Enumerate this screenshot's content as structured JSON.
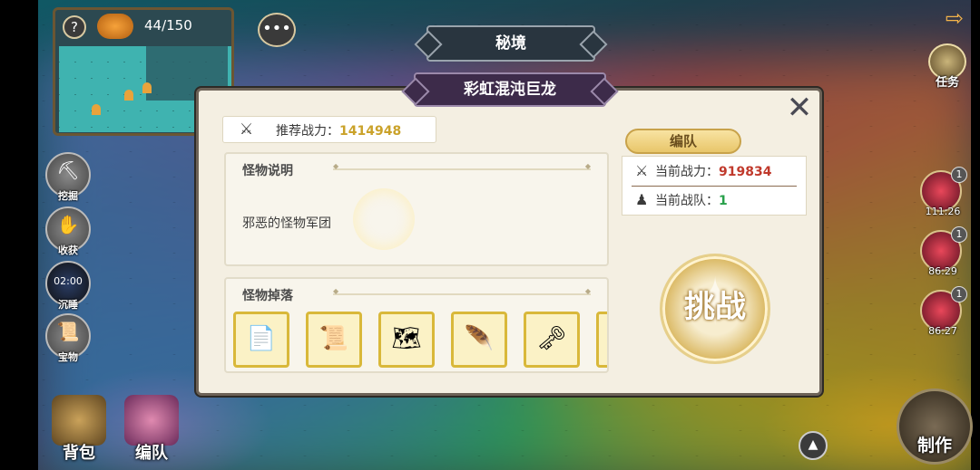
{
  "minimap": {
    "help_glyph": "?",
    "resource_count": "44/150"
  },
  "left_buttons": [
    {
      "label": "挖掘",
      "icon": "shovel-icon"
    },
    {
      "label": "收获",
      "icon": "hand-icon"
    },
    {
      "label": "沉睡",
      "timer": "02:00"
    },
    {
      "label": "宝物",
      "icon": "scroll-icon"
    }
  ],
  "bottom_buttons": {
    "bag_label": "背包",
    "team_label": "编队"
  },
  "right": {
    "task_label": "任务",
    "timers": [
      {
        "badge": "1",
        "time": "111:26"
      },
      {
        "badge": "1",
        "time": "86:29"
      },
      {
        "badge": "1",
        "time": "86:27"
      }
    ],
    "craft_label": "制作"
  },
  "header": {
    "secret_realm": "秘境",
    "boss_name": "彩虹混沌巨龙"
  },
  "panel": {
    "recommended_label": "推荐战力：",
    "recommended_value": "1414948",
    "description_header": "怪物说明",
    "description_text": "邪恶的怪物军团",
    "drops_header": "怪物掉落",
    "drops": [
      "scroll-icon",
      "map-roll-icon",
      "treasure-map-icon",
      "feather-icon",
      "heart-key-icon"
    ],
    "team_title": "编队",
    "current_power_label": "当前战力：",
    "current_power_value": "919834",
    "current_team_label": "当前战队：",
    "current_team_value": "1",
    "challenge_label": "挑战"
  },
  "colors": {
    "accent_gold": "#caa22a",
    "power_red": "#c0392b",
    "team_green": "#27a04a"
  }
}
